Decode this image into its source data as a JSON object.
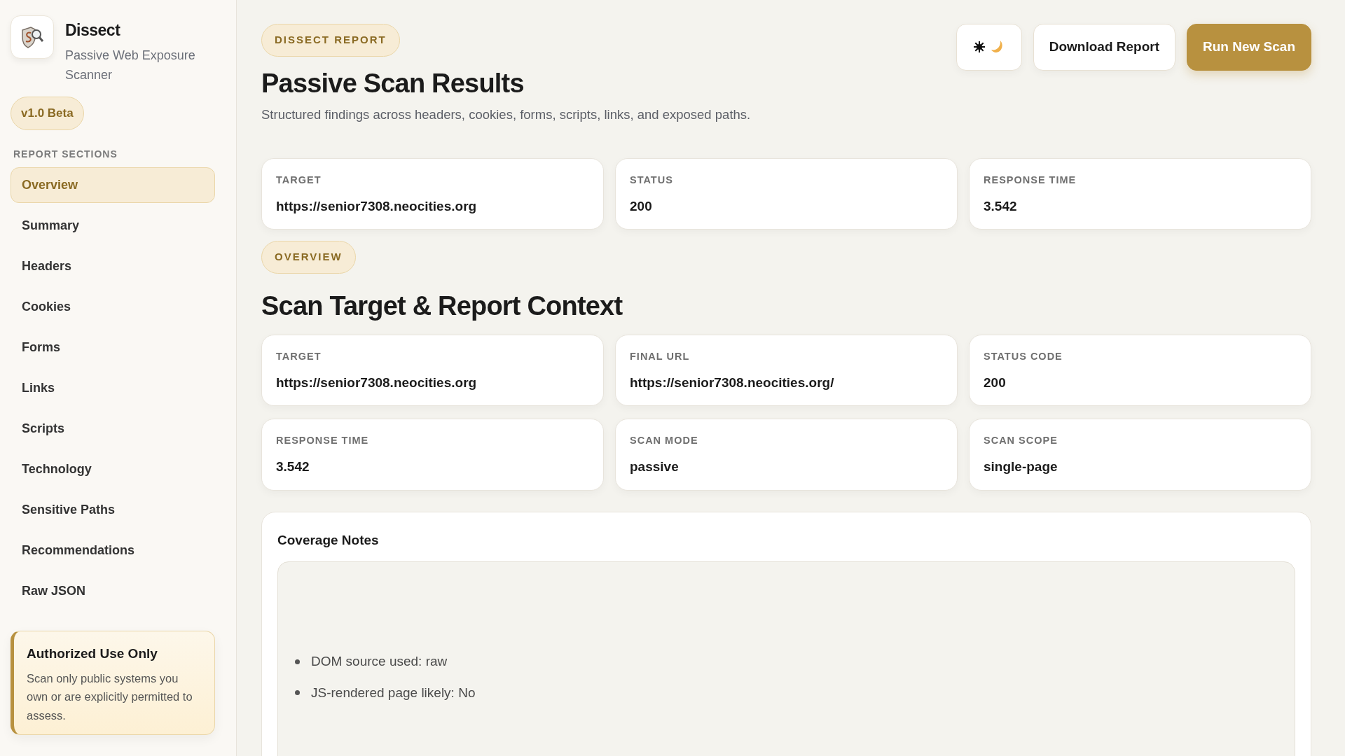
{
  "sidebar": {
    "brand": {
      "name": "Dissect",
      "tagline": "Passive Web Exposure Scanner"
    },
    "version_badge": "v1.0 Beta",
    "section_label": "REPORT SECTIONS",
    "items": [
      {
        "label": "Overview",
        "selected": true
      },
      {
        "label": "Summary",
        "selected": false
      },
      {
        "label": "Headers",
        "selected": false
      },
      {
        "label": "Cookies",
        "selected": false
      },
      {
        "label": "Forms",
        "selected": false
      },
      {
        "label": "Links",
        "selected": false
      },
      {
        "label": "Scripts",
        "selected": false
      },
      {
        "label": "Technology",
        "selected": false
      },
      {
        "label": "Sensitive Paths",
        "selected": false
      },
      {
        "label": "Recommendations",
        "selected": false
      },
      {
        "label": "Raw JSON",
        "selected": false
      }
    ],
    "notice": {
      "title": "Authorized Use Only",
      "text": "Scan only public systems you own or are explicitly permitted to assess."
    }
  },
  "header": {
    "eyebrow": "DISSECT REPORT",
    "title": "Passive Scan Results",
    "subtitle": "Structured findings across headers, cookies, forms, scripts, links, and exposed paths.",
    "buttons": [
      {
        "kind": "theme"
      },
      {
        "kind": "secondary",
        "label": "Download Report"
      },
      {
        "kind": "primary",
        "label": "Run New Scan"
      }
    ]
  },
  "stats": [
    {
      "label": "TARGET",
      "value": "https://senior7308.neocities.org"
    },
    {
      "label": "STATUS",
      "value": "200"
    },
    {
      "label": "RESPONSE TIME",
      "value": "3.542"
    }
  ],
  "overview": {
    "eyebrow": "OVERVIEW",
    "title": "Scan Target & Report Context",
    "fields": [
      {
        "label": "TARGET",
        "value": "https://senior7308.neocities.org"
      },
      {
        "label": "FINAL URL",
        "value": "https://senior7308.neocities.org/"
      },
      {
        "label": "STATUS CODE",
        "value": "200"
      },
      {
        "label": "RESPONSE TIME",
        "value": "3.542"
      },
      {
        "label": "SCAN MODE",
        "value": "passive"
      },
      {
        "label": "SCAN SCOPE",
        "value": "single-page"
      }
    ],
    "coverage": {
      "title": "Coverage Notes",
      "notes": [
        "DOM source used: raw",
        "JS-rendered page likely: No"
      ]
    }
  }
}
